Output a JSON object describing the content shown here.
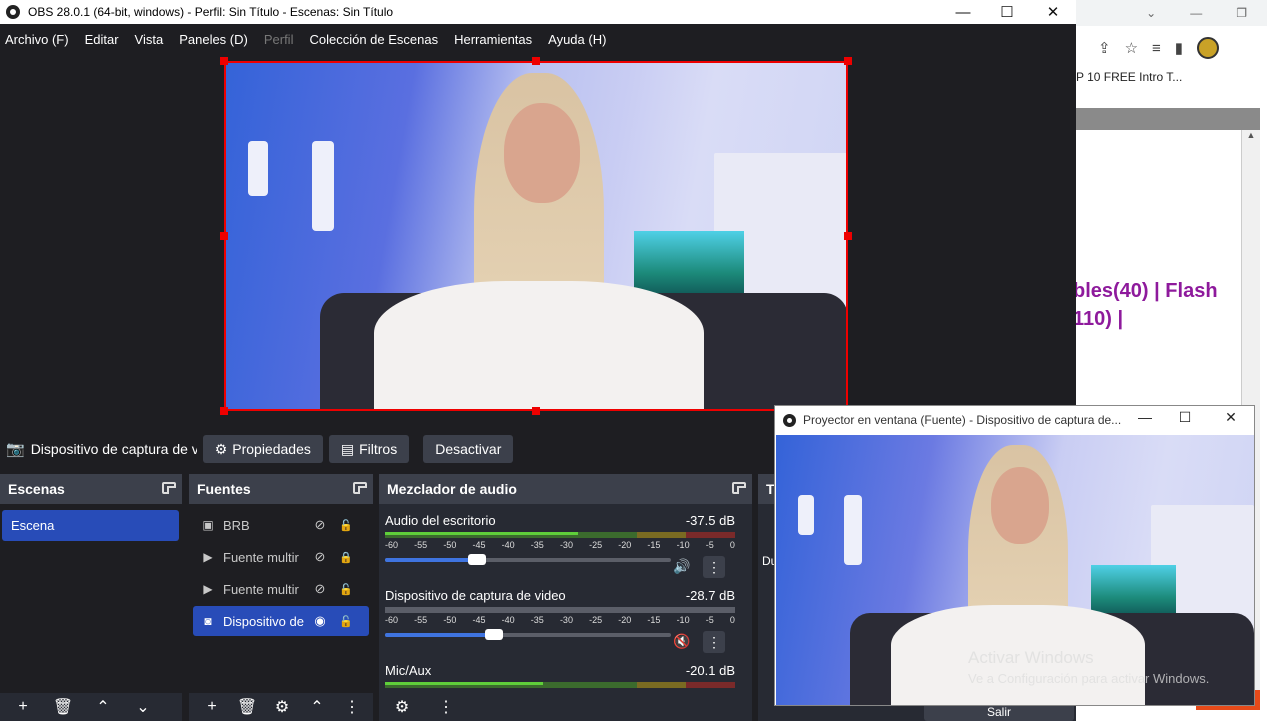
{
  "window": {
    "title": "OBS 28.0.1 (64-bit, windows) - Perfil: Sin Título - Escenas: Sin Título"
  },
  "menu": [
    "Archivo (F)",
    "Editar",
    "Vista",
    "Paneles (D)",
    "Perfil",
    "Colección de Escenas",
    "Herramientas",
    "Ayuda (H)"
  ],
  "source_toolbar": {
    "source_name": "Dispositivo de captura de v",
    "properties": "Propiedades",
    "filters": "Filtros",
    "deactivate": "Desactivar"
  },
  "scenes": {
    "title": "Escenas",
    "items": [
      "Escena"
    ]
  },
  "sources": {
    "title": "Fuentes",
    "items": [
      {
        "name": "BRB",
        "icon": "image-icon",
        "visible": false,
        "locked": false
      },
      {
        "name": "Fuente multir",
        "icon": "play-icon",
        "visible": false,
        "locked": true
      },
      {
        "name": "Fuente multir",
        "icon": "play-icon",
        "visible": false,
        "locked": false
      },
      {
        "name": "Dispositivo de",
        "icon": "camera-icon",
        "visible": true,
        "locked": false
      }
    ]
  },
  "mixer": {
    "title": "Mezclador de audio",
    "scale": [
      "-60",
      "-55",
      "-50",
      "-45",
      "-40",
      "-35",
      "-30",
      "-25",
      "-20",
      "-15",
      "-10",
      "-5",
      "0"
    ],
    "channels": [
      {
        "name": "Audio del escritorio",
        "db": "-37.5 dB",
        "level": 0.55,
        "volume": 0.32,
        "muted": false
      },
      {
        "name": "Dispositivo de captura de video",
        "db": "-28.7 dB",
        "level": 0.0,
        "volume": 0.38,
        "muted": true
      },
      {
        "name": "Mic/Aux",
        "db": "-20.1 dB",
        "level": 0.45,
        "volume": null,
        "muted": false
      }
    ]
  },
  "controls_partial": {
    "header": "T",
    "label": "Du",
    "exit": "Salir"
  },
  "projector": {
    "title": "Proyector en ventana (Fuente) - Dispositivo de captura de..."
  },
  "watermark": {
    "line1": "Activar Windows",
    "line2": "Ve a Configuración para activar Windows."
  },
  "browser": {
    "bookmark": "P 10 FREE Intro T...",
    "line1": "bles(40) | Flash",
    "line2": "110) |"
  },
  "colors": {
    "accent": "#284cb8",
    "selection": "#e00000",
    "link_purple": "#8e1a9c"
  }
}
